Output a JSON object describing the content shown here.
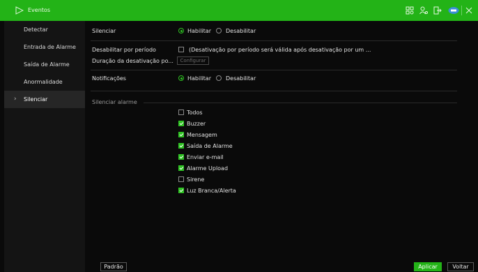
{
  "titlebar": {
    "title": "Eventos",
    "accent_color": "#23b317",
    "icons": [
      "grid-settings-icon",
      "user-settings-icon",
      "exit-icon",
      "cloud-badge-icon",
      "close-icon"
    ]
  },
  "sidebar": {
    "items": [
      {
        "label": "Detectar"
      },
      {
        "label": "Entrada de Alarme"
      },
      {
        "label": "Saída de Alarme"
      },
      {
        "label": "Anormalidade"
      },
      {
        "label": "Silenciar",
        "active": true
      }
    ]
  },
  "silenciar": {
    "label": "Silenciar",
    "enable_label": "Habilitar",
    "disable_label": "Desabilitar",
    "selected": "Habilitar"
  },
  "period": {
    "label": "Desabilitar por período",
    "checked": false,
    "note": "(Desativação por período será válida após desativação por um ..."
  },
  "duration": {
    "label": "Duração da desativação po...",
    "button_label": "Configurar"
  },
  "notificacoes": {
    "label": "Notificações",
    "enable_label": "Habilitar",
    "disable_label": "Desabilitar",
    "selected": "Habilitar"
  },
  "silenciar_alarme": {
    "label": "Silenciar alarme",
    "options": [
      {
        "label": "Todos",
        "checked": false
      },
      {
        "label": "Buzzer",
        "checked": true
      },
      {
        "label": "Mensagem",
        "checked": true
      },
      {
        "label": "Saída de Alarme",
        "checked": true
      },
      {
        "label": "Enviar e-mail",
        "checked": true
      },
      {
        "label": "Alarme Upload",
        "checked": true
      },
      {
        "label": "Sirene",
        "checked": false
      },
      {
        "label": "Luz Branca/Alerta",
        "checked": true
      }
    ]
  },
  "footer": {
    "default_label": "Padrão",
    "apply_label": "Aplicar",
    "back_label": "Voltar"
  }
}
